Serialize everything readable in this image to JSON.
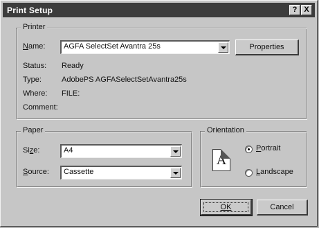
{
  "window": {
    "title": "Print Setup",
    "help_glyph": "?",
    "close_glyph": "X"
  },
  "printer": {
    "group_label": "Printer",
    "name_label": "Name:",
    "name_value": "AGFA SelectSet Avantra 25s",
    "properties_label": "Properties",
    "status_label": "Status:",
    "status_value": "Ready",
    "type_label": "Type:",
    "type_value": "AdobePS AGFASelectSetAvantra25s",
    "where_label": "Where:",
    "where_value": "FILE:",
    "comment_label": "Comment:",
    "comment_value": ""
  },
  "paper": {
    "group_label": "Paper",
    "size_label": "Size:",
    "size_value": "A4",
    "source_label": "Source:",
    "source_value": "Cassette"
  },
  "orientation": {
    "group_label": "Orientation",
    "icon_letter": "A",
    "portrait_label": "Portrait",
    "landscape_label": "Landscape",
    "selected": "portrait"
  },
  "footer": {
    "ok_label": "OK",
    "cancel_label": "Cancel"
  },
  "icons": [
    "help-icon",
    "close-icon",
    "chevron-down-icon",
    "page-portrait-icon"
  ]
}
